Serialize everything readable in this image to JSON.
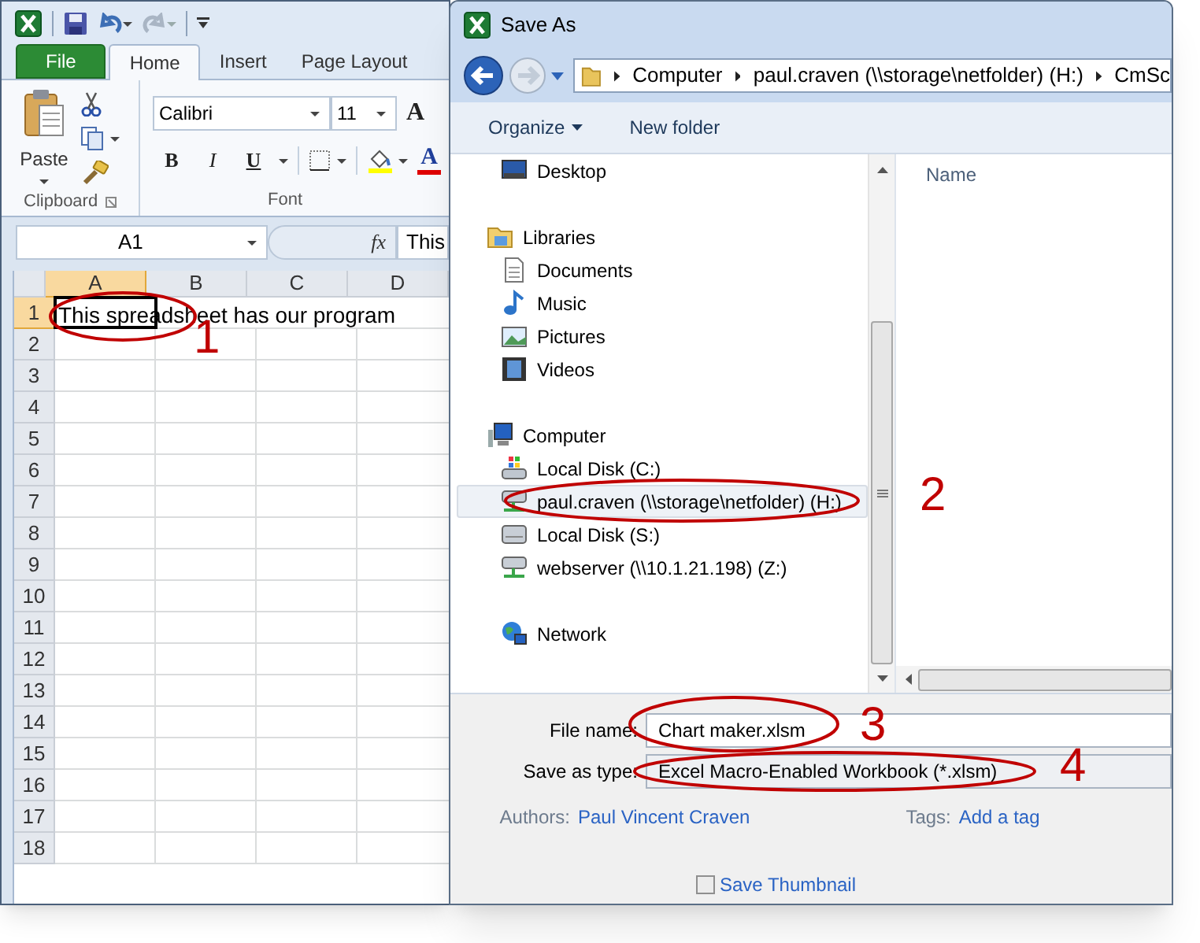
{
  "excel": {
    "ribbon_tabs": [
      {
        "label": "File",
        "kind": "file",
        "selected": false
      },
      {
        "label": "Home",
        "kind": "tab",
        "selected": true
      },
      {
        "label": "Insert",
        "kind": "tab",
        "selected": false
      },
      {
        "label": "Page Layout",
        "kind": "tab",
        "selected": false
      }
    ],
    "clipboard": {
      "paste_label": "Paste",
      "group_label": "Clipboard"
    },
    "font": {
      "font_name": "Calibri",
      "font_size": "11",
      "grow_font": "A",
      "buttons": [
        {
          "label": "B",
          "kind": "bold"
        },
        {
          "label": "I",
          "kind": "italic"
        },
        {
          "label": "U",
          "kind": "underline"
        }
      ],
      "font_color": "A",
      "group_label": "Font"
    },
    "name_box": "A1",
    "function_label": "fx",
    "formula": "This",
    "columns": [
      {
        "label": "A",
        "selected": true
      },
      {
        "label": "B",
        "selected": false
      },
      {
        "label": "C",
        "selected": false
      },
      {
        "label": "D",
        "selected": false
      }
    ],
    "rows": [
      {
        "label": "1",
        "selected": true
      },
      {
        "label": "2",
        "selected": false
      },
      {
        "label": "3",
        "selected": false
      },
      {
        "label": "4",
        "selected": false
      },
      {
        "label": "5",
        "selected": false
      },
      {
        "label": "6",
        "selected": false
      },
      {
        "label": "7",
        "selected": false
      },
      {
        "label": "8",
        "selected": false
      },
      {
        "label": "9",
        "selected": false
      },
      {
        "label": "10",
        "selected": false
      },
      {
        "label": "11",
        "selected": false
      },
      {
        "label": "12",
        "selected": false
      },
      {
        "label": "13",
        "selected": false
      },
      {
        "label": "14",
        "selected": false
      },
      {
        "label": "15",
        "selected": false
      },
      {
        "label": "16",
        "selected": false
      },
      {
        "label": "17",
        "selected": false
      },
      {
        "label": "18",
        "selected": false
      }
    ],
    "cell_a1": "This spreadsheet has our program"
  },
  "save_as": {
    "title": "Save As",
    "breadcrumbs": [
      "Computer",
      "paul.craven (\\\\storage\\netfolder) (H:)",
      "CmSc"
    ],
    "toolbar": [
      {
        "label": "Organize",
        "kind": "menu"
      },
      {
        "label": "New folder",
        "kind": "button"
      }
    ],
    "nav_tree": [
      {
        "label": "Desktop",
        "kind": "desktop",
        "selected": false
      },
      {
        "label": "Libraries",
        "kind": "library",
        "selected": false,
        "children": [
          {
            "label": "Documents",
            "kind": "documents",
            "selected": false
          },
          {
            "label": "Music",
            "kind": "music",
            "selected": false
          },
          {
            "label": "Pictures",
            "kind": "pictures",
            "selected": false
          },
          {
            "label": "Videos",
            "kind": "videos",
            "selected": false
          }
        ]
      },
      {
        "label": "Computer",
        "kind": "computer",
        "selected": false,
        "children": [
          {
            "label": "Local Disk (C:)",
            "kind": "system_disk",
            "selected": false
          },
          {
            "label": "paul.craven (\\\\storage\\netfolder) (H:)",
            "kind": "network_drive",
            "selected": true
          },
          {
            "label": "Local Disk (S:)",
            "kind": "disk",
            "selected": false
          },
          {
            "label": "webserver (\\\\10.1.21.198) (Z:)",
            "kind": "network_drive",
            "selected": false
          }
        ]
      },
      {
        "label": "Network",
        "kind": "network",
        "selected": false
      }
    ],
    "column_header": "Name",
    "file_name": {
      "label": "File name:",
      "value": "Chart maker.xlsm"
    },
    "save_as_type": {
      "label": "Save as type:",
      "value": "Excel Macro-Enabled Workbook (*.xlsm)"
    },
    "authors": {
      "label": "Authors:",
      "value": "Paul Vincent Craven"
    },
    "tags": {
      "label": "Tags:",
      "value": "Add a tag"
    },
    "save_thumbnail": {
      "label": "Save Thumbnail",
      "checked": false
    }
  },
  "annotations": [
    {
      "number": "1"
    },
    {
      "number": "2"
    },
    {
      "number": "3"
    },
    {
      "number": "4"
    }
  ]
}
